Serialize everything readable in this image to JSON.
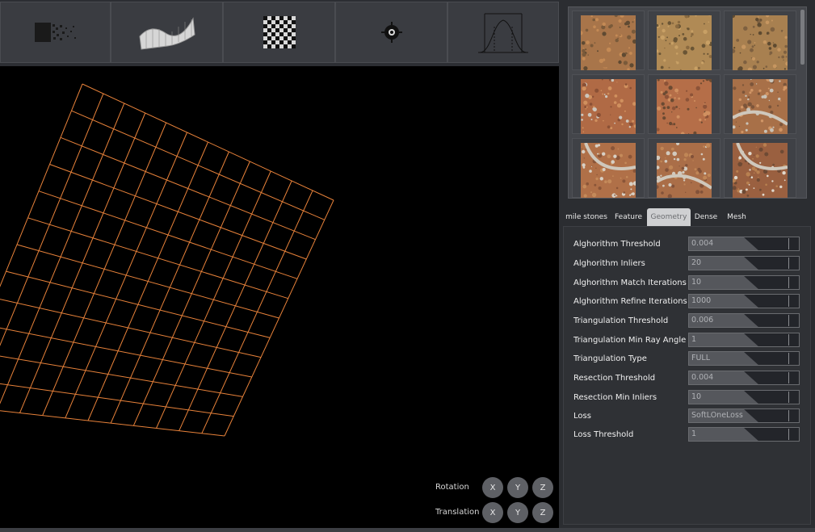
{
  "toolbar": {
    "tools": [
      {
        "name": "dither-tool"
      },
      {
        "name": "surface-tool"
      },
      {
        "name": "checkerboard-tool"
      },
      {
        "name": "target-tool"
      },
      {
        "name": "distribution-tool"
      }
    ]
  },
  "viewport": {
    "rotation_label": "Rotation",
    "translation_label": "Translation",
    "axes": [
      "X",
      "Y",
      "Z"
    ]
  },
  "gallery": {
    "thumbnail_count": 9
  },
  "tabs": [
    "mile stones",
    "Feature",
    "Geometry",
    "Dense",
    "Mesh"
  ],
  "active_tab": "Geometry",
  "properties": [
    {
      "label": "Alghorithm Threshold",
      "value": "0.004"
    },
    {
      "label": "Alghorithm Inliers",
      "value": "20"
    },
    {
      "label": "Alghorithm Match Iterations",
      "value": "10"
    },
    {
      "label": "Alghorithm Refine Iterations",
      "value": "1000"
    },
    {
      "label": "Triangulation Threshold",
      "value": "0.006"
    },
    {
      "label": "Triangulation Min Ray Angle",
      "value": "1"
    },
    {
      "label": "Triangulation Type",
      "value": "FULL"
    },
    {
      "label": "Resection Threshold",
      "value": "0.004"
    },
    {
      "label": "Resection Min Inliers",
      "value": "10"
    },
    {
      "label": "Loss",
      "value": "SoftLOneLoss"
    },
    {
      "label": "Loss Threshold",
      "value": "1"
    }
  ],
  "colors": {
    "grid_line": "#e8823a",
    "viewport_bg": "#000000",
    "panel_bg": "#2b2d31",
    "active_tab_bg": "#cfd0d2"
  }
}
